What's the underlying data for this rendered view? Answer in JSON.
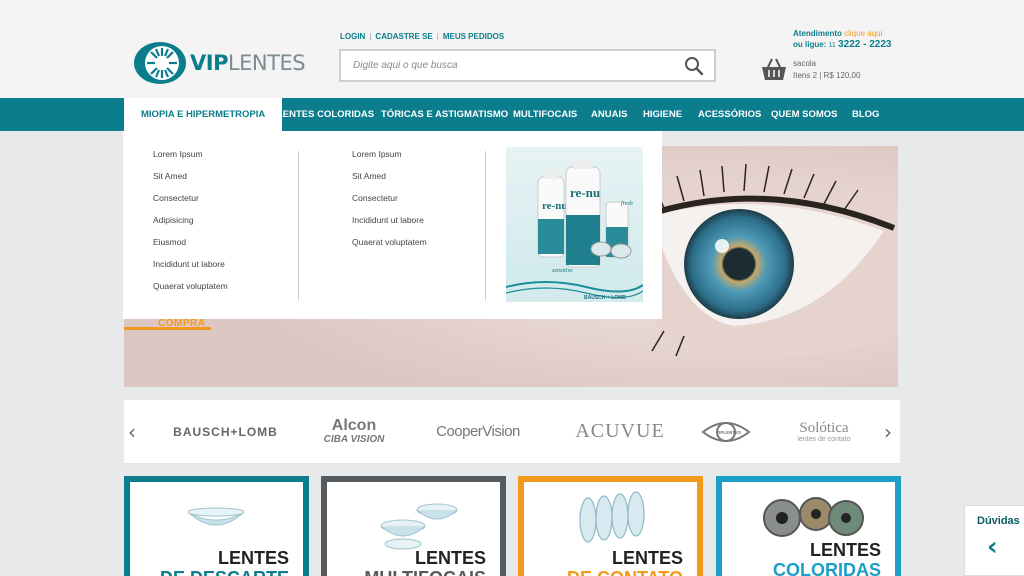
{
  "header": {
    "logo": {
      "bold": "VIP",
      "light": "LENTES"
    },
    "toplinks": [
      "LOGIN",
      "CADASTRE SE",
      "MEUS PEDIDOS"
    ],
    "toplinks_sep": "|",
    "search_placeholder": "Digite aqui o que busca",
    "contact": {
      "line1_label": "Atendimento",
      "line1_link": "clique aqui",
      "line2_label": "ou ligue:",
      "ddd": "11",
      "phone": "3222 - 2223"
    },
    "cart": {
      "title": "sacola",
      "summary": "Itens 2 | R$ 120,00"
    }
  },
  "nav": {
    "items": [
      "MIOPIA E HIPERMETROPIA",
      "LENTES COLORIDAS",
      "TÓRICAS E ASTIGMATISMO",
      "MULTIFOCAIS",
      "ANUAIS",
      "HIGIENE",
      "ACESSÓRIOS",
      "QUEM SOMOS",
      "BLOG"
    ]
  },
  "dropdown": {
    "col1": [
      "Lorem Ipsum",
      "Sit Amed",
      "Consectetur",
      "Adipisicing",
      "Eiusmod",
      "Incididunt ut labore",
      "Quaerat voluptatem"
    ],
    "col2": [
      "Lorem Ipsum",
      "Sit Amed",
      "Consectetur",
      "Incididunt ut labore",
      "Quaerat voluptatem"
    ],
    "promo": {
      "brand_short": "re-nu",
      "variant": "sensitive",
      "maker": "BAUSCH + LOMB",
      "tag": "fresh"
    }
  },
  "hero": {
    "cta": "COMPRA"
  },
  "brands": {
    "prev_arrow": "‹",
    "next_arrow": "›",
    "items": [
      {
        "line1": "BAUSCH+LOMB"
      },
      {
        "line1": "Alcon",
        "line2": "CIBA VISION"
      },
      {
        "line1": "CooperVision"
      },
      {
        "line1": "ACUVUE"
      },
      {
        "line1": "VIPLENTES"
      },
      {
        "line1": "Solótica",
        "line2": "lentes de contato"
      }
    ]
  },
  "cards": [
    {
      "line1": "LENTES",
      "line2": "DE DESCARTE",
      "color": "#0b7d8c"
    },
    {
      "line1": "LENTES",
      "line2": "MULTIFOCAIS",
      "color": "#555b5e"
    },
    {
      "line1": "LENTES",
      "line2": "DE CONTATO",
      "color": "#f39a1e"
    },
    {
      "line1": "LENTES",
      "line2": "COLORIDAS",
      "color": "#1a9fc6"
    }
  ],
  "help": {
    "label": "Dúvidas",
    "arrow": "‹"
  },
  "colors": {
    "brand": "#0b7d8c",
    "accent": "#f39a1e"
  }
}
